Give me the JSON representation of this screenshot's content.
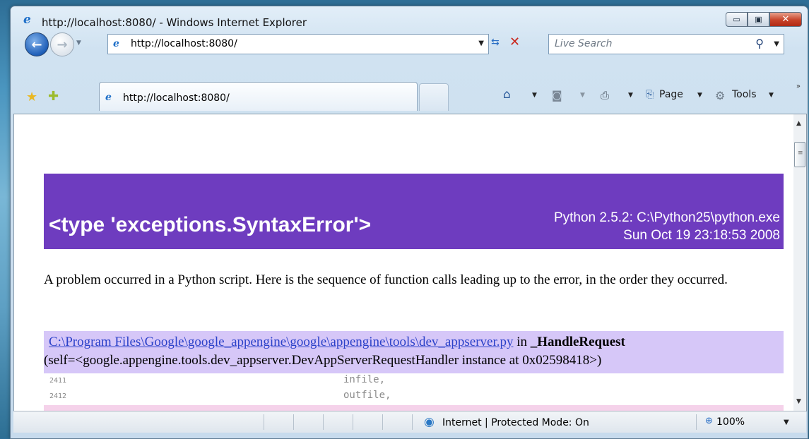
{
  "window": {
    "title": "http://localhost:8080/ - Windows Internet Explorer",
    "minimize_label": "▭",
    "maximize_label": "▣",
    "close_label": "✕"
  },
  "nav": {
    "address": "http://localhost:8080/",
    "search_placeholder": "Live Search"
  },
  "tabs": [
    {
      "label": "http://localhost:8080/"
    }
  ],
  "command_bar": {
    "page_label": "Page",
    "tools_label": "Tools"
  },
  "page": {
    "exception_title": "<type 'exceptions.SyntaxError'>",
    "python_version": "Python 2.5.2: C:\\Python25\\python.exe",
    "datetime": "Sun Oct 19 23:18:53 2008",
    "intro": "A problem occurred in a Python script. Here is the sequence of function calls leading up to the error, in the order they occurred.",
    "frame": {
      "file_link": "C:\\Program Files\\Google\\google_appengine\\google\\appengine\\tools\\dev_appserver.py",
      "in_text": "in",
      "function": "_HandleRequest",
      "args": "(self=<google.appengine.tools.dev_appserver.DevAppServerRequestHandler instance at 0x02598418>)"
    },
    "code_lines": [
      {
        "lineno": "2411",
        "code": "infile,"
      },
      {
        "lineno": "2412",
        "code": "outfile,"
      }
    ]
  },
  "status": {
    "zone": "Internet | Protected Mode: On",
    "zoom": "100%"
  },
  "colors": {
    "heading_band": "#6e3cbf",
    "frame_header": "#d6c7f8",
    "error_line": "#f5d2ea",
    "link": "#2b41c9"
  },
  "icons": [
    "ie-logo-icon",
    "back-arrow-icon",
    "forward-arrow-icon",
    "refresh-icon",
    "stop-icon",
    "search-icon",
    "favorites-star-icon",
    "add-favorites-icon",
    "home-icon",
    "feeds-icon",
    "print-icon",
    "page-icon",
    "tools-gear-icon",
    "globe-icon",
    "zoom-icon"
  ]
}
